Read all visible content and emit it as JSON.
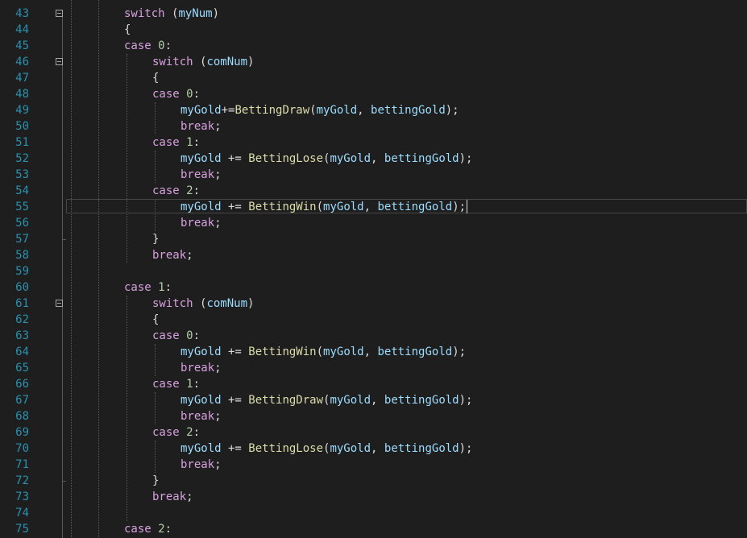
{
  "editor": {
    "lines": [
      {
        "n": "43",
        "indent": 0,
        "fold": true,
        "tokens": [
          [
            "kw",
            "switch"
          ],
          [
            "pl",
            " ("
          ],
          [
            "var",
            "myNum"
          ],
          [
            "pl",
            ")"
          ]
        ]
      },
      {
        "n": "44",
        "indent": 0,
        "tokens": [
          [
            "pl",
            "{"
          ]
        ]
      },
      {
        "n": "45",
        "indent": 0,
        "tokens": [
          [
            "kw",
            "case"
          ],
          [
            "pl",
            " "
          ],
          [
            "num",
            "0"
          ],
          [
            "pl",
            ":"
          ]
        ]
      },
      {
        "n": "46",
        "indent": 1,
        "fold": true,
        "tokens": [
          [
            "kw",
            "switch"
          ],
          [
            "pl",
            " ("
          ],
          [
            "var",
            "comNum"
          ],
          [
            "pl",
            ")"
          ]
        ]
      },
      {
        "n": "47",
        "indent": 1,
        "tokens": [
          [
            "pl",
            "{"
          ]
        ]
      },
      {
        "n": "48",
        "indent": 1,
        "tokens": [
          [
            "kw",
            "case"
          ],
          [
            "pl",
            " "
          ],
          [
            "num",
            "0"
          ],
          [
            "pl",
            ":"
          ]
        ]
      },
      {
        "n": "49",
        "indent": 2,
        "tokens": [
          [
            "var",
            "myGold"
          ],
          [
            "pl",
            "+="
          ],
          [
            "fn",
            "BettingDraw"
          ],
          [
            "pl",
            "("
          ],
          [
            "var",
            "myGold"
          ],
          [
            "pl",
            ", "
          ],
          [
            "var",
            "bettingGold"
          ],
          [
            "pl",
            ");"
          ]
        ]
      },
      {
        "n": "50",
        "indent": 2,
        "tokens": [
          [
            "kw",
            "break"
          ],
          [
            "pl",
            ";"
          ]
        ]
      },
      {
        "n": "51",
        "indent": 1,
        "tokens": [
          [
            "kw",
            "case"
          ],
          [
            "pl",
            " "
          ],
          [
            "num",
            "1"
          ],
          [
            "pl",
            ":"
          ]
        ]
      },
      {
        "n": "52",
        "indent": 2,
        "tokens": [
          [
            "var",
            "myGold"
          ],
          [
            "pl",
            " += "
          ],
          [
            "fn",
            "BettingLose"
          ],
          [
            "pl",
            "("
          ],
          [
            "var",
            "myGold"
          ],
          [
            "pl",
            ", "
          ],
          [
            "var",
            "bettingGold"
          ],
          [
            "pl",
            ");"
          ]
        ]
      },
      {
        "n": "53",
        "indent": 2,
        "tokens": [
          [
            "kw",
            "break"
          ],
          [
            "pl",
            ";"
          ]
        ]
      },
      {
        "n": "54",
        "indent": 1,
        "tokens": [
          [
            "kw",
            "case"
          ],
          [
            "pl",
            " "
          ],
          [
            "num",
            "2"
          ],
          [
            "pl",
            ":"
          ]
        ]
      },
      {
        "n": "55",
        "indent": 2,
        "current": true,
        "tokens": [
          [
            "var",
            "myGold"
          ],
          [
            "pl",
            " += "
          ],
          [
            "fn",
            "BettingWin"
          ],
          [
            "pl",
            "("
          ],
          [
            "var",
            "myGold"
          ],
          [
            "pl",
            ", "
          ],
          [
            "var",
            "bettingGold"
          ],
          [
            "pl",
            ");"
          ]
        ]
      },
      {
        "n": "56",
        "indent": 2,
        "tokens": [
          [
            "kw",
            "break"
          ],
          [
            "pl",
            ";"
          ]
        ]
      },
      {
        "n": "57",
        "indent": 1,
        "tokens": [
          [
            "pl",
            "}"
          ]
        ]
      },
      {
        "n": "58",
        "indent": 1,
        "tokens": [
          [
            "kw",
            "break"
          ],
          [
            "pl",
            ";"
          ]
        ]
      },
      {
        "n": "59",
        "indent": 0,
        "tokens": []
      },
      {
        "n": "60",
        "indent": 0,
        "tokens": [
          [
            "kw",
            "case"
          ],
          [
            "pl",
            " "
          ],
          [
            "num",
            "1"
          ],
          [
            "pl",
            ":"
          ]
        ]
      },
      {
        "n": "61",
        "indent": 1,
        "fold": true,
        "tokens": [
          [
            "kw",
            "switch"
          ],
          [
            "pl",
            " ("
          ],
          [
            "var",
            "comNum"
          ],
          [
            "pl",
            ")"
          ]
        ]
      },
      {
        "n": "62",
        "indent": 1,
        "tokens": [
          [
            "pl",
            "{"
          ]
        ]
      },
      {
        "n": "63",
        "indent": 1,
        "tokens": [
          [
            "kw",
            "case"
          ],
          [
            "pl",
            " "
          ],
          [
            "num",
            "0"
          ],
          [
            "pl",
            ":"
          ]
        ]
      },
      {
        "n": "64",
        "indent": 2,
        "tokens": [
          [
            "var",
            "myGold"
          ],
          [
            "pl",
            " += "
          ],
          [
            "fn",
            "BettingWin"
          ],
          [
            "pl",
            "("
          ],
          [
            "var",
            "myGold"
          ],
          [
            "pl",
            ", "
          ],
          [
            "var",
            "bettingGold"
          ],
          [
            "pl",
            ");"
          ]
        ]
      },
      {
        "n": "65",
        "indent": 2,
        "tokens": [
          [
            "kw",
            "break"
          ],
          [
            "pl",
            ";"
          ]
        ]
      },
      {
        "n": "66",
        "indent": 1,
        "tokens": [
          [
            "kw",
            "case"
          ],
          [
            "pl",
            " "
          ],
          [
            "num",
            "1"
          ],
          [
            "pl",
            ":"
          ]
        ]
      },
      {
        "n": "67",
        "indent": 2,
        "tokens": [
          [
            "var",
            "myGold"
          ],
          [
            "pl",
            " += "
          ],
          [
            "fn",
            "BettingDraw"
          ],
          [
            "pl",
            "("
          ],
          [
            "var",
            "myGold"
          ],
          [
            "pl",
            ", "
          ],
          [
            "var",
            "bettingGold"
          ],
          [
            "pl",
            ");"
          ]
        ]
      },
      {
        "n": "68",
        "indent": 2,
        "tokens": [
          [
            "kw",
            "break"
          ],
          [
            "pl",
            ";"
          ]
        ]
      },
      {
        "n": "69",
        "indent": 1,
        "tokens": [
          [
            "kw",
            "case"
          ],
          [
            "pl",
            " "
          ],
          [
            "num",
            "2"
          ],
          [
            "pl",
            ":"
          ]
        ]
      },
      {
        "n": "70",
        "indent": 2,
        "tokens": [
          [
            "var",
            "myGold"
          ],
          [
            "pl",
            " += "
          ],
          [
            "fn",
            "BettingLose"
          ],
          [
            "pl",
            "("
          ],
          [
            "var",
            "myGold"
          ],
          [
            "pl",
            ", "
          ],
          [
            "var",
            "bettingGold"
          ],
          [
            "pl",
            ");"
          ]
        ]
      },
      {
        "n": "71",
        "indent": 2,
        "tokens": [
          [
            "kw",
            "break"
          ],
          [
            "pl",
            ";"
          ]
        ]
      },
      {
        "n": "72",
        "indent": 1,
        "tokens": [
          [
            "pl",
            "}"
          ]
        ]
      },
      {
        "n": "73",
        "indent": 1,
        "tokens": [
          [
            "kw",
            "break"
          ],
          [
            "pl",
            ";"
          ]
        ]
      },
      {
        "n": "74",
        "indent": 0,
        "tokens": []
      },
      {
        "n": "75",
        "indent": 0,
        "tokens": [
          [
            "kw",
            "case"
          ],
          [
            "pl",
            " "
          ],
          [
            "num",
            "2"
          ],
          [
            "pl",
            ":"
          ]
        ]
      }
    ]
  },
  "colors": {
    "background": "#1e1e1e",
    "line_number": "#2b91af",
    "keyword": "#d8a0df",
    "variable": "#9cdcfe",
    "function": "#dcdcaa",
    "number": "#b5cea8",
    "plain": "#dcdcdc"
  }
}
